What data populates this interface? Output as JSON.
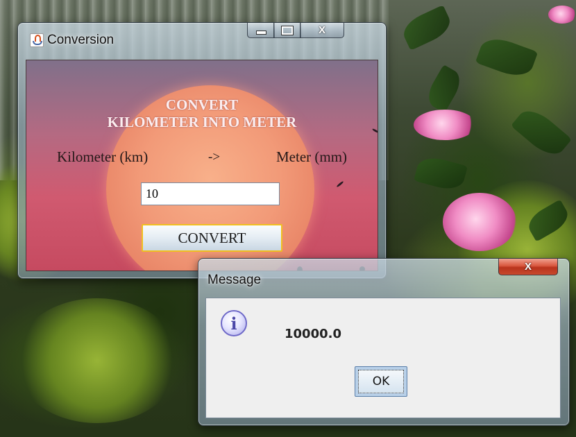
{
  "conversion_window": {
    "title": "Conversion",
    "controls": {
      "minimize": "minimize-icon",
      "maximize": "maximize-icon",
      "close": "X"
    },
    "heading_line1": "CONVERT",
    "heading_line2": "KILOMETER INTO METER",
    "from_label": "Kilometer (km)",
    "arrow": "->",
    "to_label": "Meter (mm)",
    "input_value": "10",
    "convert_button": "CONVERT"
  },
  "message_dialog": {
    "title": "Message",
    "close": "X",
    "icon": "info-icon",
    "icon_glyph": "i",
    "text": "10000.0",
    "ok_button": "OK"
  },
  "colors": {
    "content_gradient_top": "#80708a",
    "content_gradient_bottom": "#c64a60",
    "moon": "#f29a78",
    "heading_text": "#fbeef0",
    "button_focus_border": "#f0c020",
    "close_button_red": "#d9573e"
  }
}
